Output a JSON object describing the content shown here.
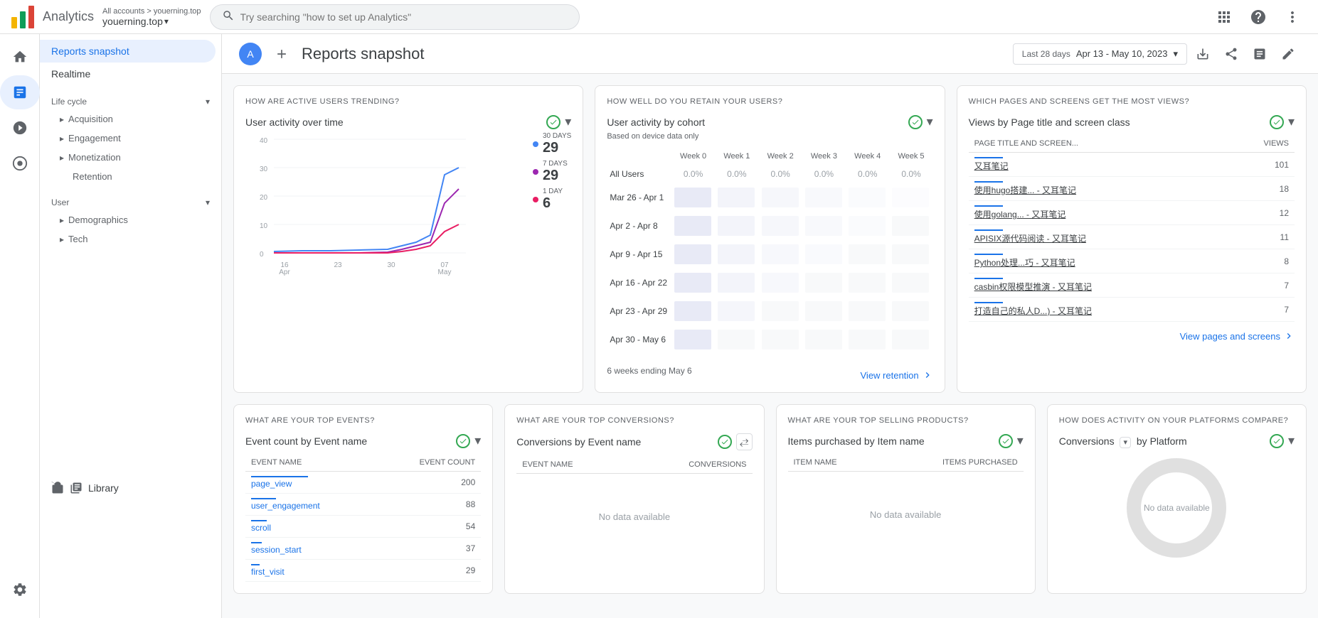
{
  "app": {
    "name": "Analytics"
  },
  "topbar": {
    "account_path": "All accounts > youerning.top",
    "account_name": "youerning.top",
    "search_placeholder": "Try searching \"how to set up Analytics\"",
    "date_range_prefix": "Last 28 days",
    "date_range": "Apr 13 - May 10, 2023"
  },
  "sidebar": {
    "active_item": "Reports snapshot",
    "items": [
      {
        "label": "Reports snapshot"
      },
      {
        "label": "Realtime"
      }
    ],
    "sections": [
      {
        "label": "Life cycle",
        "expanded": true,
        "items": [
          "Acquisition",
          "Engagement",
          "Monetization",
          "Retention"
        ]
      },
      {
        "label": "User",
        "expanded": true,
        "items": [
          "Demographics",
          "Tech"
        ]
      }
    ],
    "library": "Library"
  },
  "header": {
    "title": "Reports snapshot",
    "avatar_letter": "A"
  },
  "card1": {
    "section_title": "HOW ARE ACTIVE USERS TRENDING?",
    "title": "User activity over time",
    "legend": [
      {
        "label": "30 DAYS",
        "value": "29",
        "color": "#4285f4"
      },
      {
        "label": "7 DAYS",
        "value": "29",
        "color": "#9c27b0"
      },
      {
        "label": "1 DAY",
        "value": "6",
        "color": "#e91e63"
      }
    ],
    "x_labels": [
      "16\nApr",
      "23",
      "30",
      "07\nMay"
    ],
    "y_labels": [
      "40",
      "30",
      "20",
      "10",
      "0"
    ]
  },
  "card2": {
    "section_title": "HOW WELL DO YOU RETAIN YOUR USERS?",
    "title": "User activity by cohort",
    "subtitle": "Based on device data only",
    "view_link": "View retention",
    "weeks": [
      "Week 0",
      "Week 1",
      "Week 2",
      "Week 3",
      "Week 4",
      "Week 5"
    ],
    "rows": [
      {
        "label": "All Users",
        "values": [
          "0.0%",
          "0.0%",
          "0.0%",
          "0.0%",
          "0.0%",
          "0.0%"
        ]
      },
      {
        "label": "Mar 26 - Apr 1",
        "values": [
          "",
          "",
          "",
          "",
          "",
          ""
        ]
      },
      {
        "label": "Apr 2 - Apr 8",
        "values": [
          "",
          "",
          "",
          "",
          "",
          ""
        ]
      },
      {
        "label": "Apr 9 - Apr 15",
        "values": [
          "",
          "",
          "",
          "",
          "",
          ""
        ]
      },
      {
        "label": "Apr 16 - Apr 22",
        "values": [
          "",
          "",
          "",
          "",
          "",
          ""
        ]
      },
      {
        "label": "Apr 23 - Apr 29",
        "values": [
          "",
          "",
          "",
          "",
          "",
          ""
        ]
      },
      {
        "label": "Apr 30 - May 6",
        "values": [
          "",
          "",
          "",
          "",
          "",
          ""
        ]
      }
    ],
    "footer": "6 weeks ending May 6"
  },
  "card3": {
    "section_title": "WHICH PAGES AND SCREENS GET THE MOST VIEWS?",
    "title": "Views by Page title and screen class",
    "col1": "PAGE TITLE AND SCREEN...",
    "col2": "VIEWS",
    "view_link": "View pages and screens",
    "rows": [
      {
        "page": "又耳笔记",
        "views": "101",
        "bar_pct": 100
      },
      {
        "page": "使用hugo搭建... - 又耳笔记",
        "views": "18",
        "bar_pct": 18
      },
      {
        "page": "使用golang... - 又耳笔记",
        "views": "12",
        "bar_pct": 12
      },
      {
        "page": "APISIX源代码阅读 - 又耳笔记",
        "views": "11",
        "bar_pct": 11
      },
      {
        "page": "Python处理...巧 - 又耳笔记",
        "views": "8",
        "bar_pct": 8
      },
      {
        "page": "casbin权限模型推演 - 又耳笔记",
        "views": "7",
        "bar_pct": 7
      },
      {
        "page": "打造自己的私人D...) - 又耳笔记",
        "views": "7",
        "bar_pct": 7
      }
    ]
  },
  "card4": {
    "section_title": "WHAT ARE YOUR TOP EVENTS?",
    "title": "Event count by Event name",
    "col1": "EVENT NAME",
    "col2": "EVENT COUNT",
    "rows": [
      {
        "name": "page_view",
        "count": "200",
        "bar_pct": 100
      },
      {
        "name": "user_engagement",
        "count": "88",
        "bar_pct": 44
      },
      {
        "name": "scroll",
        "count": "54",
        "bar_pct": 27
      },
      {
        "name": "session_start",
        "count": "37",
        "bar_pct": 18
      },
      {
        "name": "first_visit",
        "count": "29",
        "bar_pct": 14
      }
    ]
  },
  "card5": {
    "section_title": "WHAT ARE YOUR TOP CONVERSIONS?",
    "title": "Conversions by Event name",
    "col1": "EVENT NAME",
    "col2": "CONVERSIONS",
    "no_data": "No data available"
  },
  "card6": {
    "section_title": "WHAT ARE YOUR TOP SELLING PRODUCTS?",
    "title": "Items purchased by Item name",
    "col1": "ITEM NAME",
    "col2": "ITEMS PURCHASED",
    "no_data": "No data available"
  },
  "card7": {
    "section_title": "HOW DOES ACTIVITY ON YOUR PLATFORMS COMPARE?",
    "title_prefix": "Conversions",
    "title_suffix": "by Platform",
    "no_data": "No data available"
  },
  "icons": {
    "search": "🔍",
    "chevron_down": "▾",
    "chevron_right": "▸",
    "settings": "⚙",
    "help": "?",
    "dots": "⋮",
    "home": "🏠",
    "bar_chart": "📊",
    "person": "👤",
    "target": "🎯",
    "gear": "⚙",
    "library": "📁",
    "edit": "✏",
    "share": "↗",
    "compare": "⟷",
    "arrow_right": "→",
    "checkmark": "✓",
    "plus": "+",
    "apps": "⊞"
  }
}
